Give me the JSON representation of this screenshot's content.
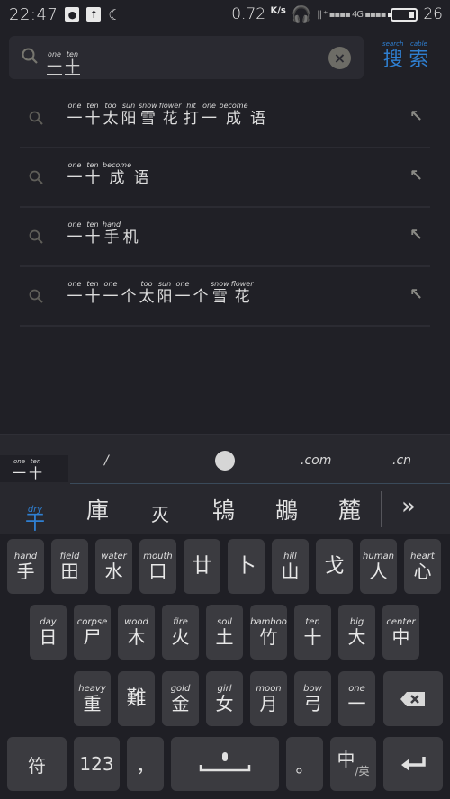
{
  "status_bar": {
    "time": "22:47",
    "left_icons": [
      "qq-icon",
      "upload-icon",
      "moon-icon"
    ],
    "net_speed": "0.72",
    "net_unit": "K/s",
    "signal": "4G",
    "battery_percent": "26"
  },
  "search": {
    "query": [
      {
        "hint": "one",
        "char": "一"
      },
      {
        "hint": "ten",
        "char": "十"
      }
    ],
    "clear_label": "×",
    "button": [
      {
        "hint": "search",
        "char": "搜"
      },
      {
        "hint": "cable",
        "char": "索"
      }
    ]
  },
  "suggestions": [
    {
      "chars": [
        {
          "hint": "one",
          "char": "一"
        },
        {
          "hint": "ten",
          "char": "十"
        },
        {
          "hint": "too",
          "char": "太"
        },
        {
          "hint": "sun",
          "char": "阳"
        },
        {
          "hint": "snow",
          "char": "雪"
        },
        {
          "hint": "flower",
          "char": "花"
        },
        {
          "hint": "hit",
          "char": "打"
        },
        {
          "hint": "one",
          "char": "一"
        },
        {
          "hint": "become",
          "char": "成"
        },
        {
          "hint": "",
          "char": "语"
        }
      ]
    },
    {
      "chars": [
        {
          "hint": "one",
          "char": "一"
        },
        {
          "hint": "ten",
          "char": "十"
        },
        {
          "hint": "become",
          "char": "成"
        },
        {
          "hint": "",
          "char": "语"
        }
      ]
    },
    {
      "chars": [
        {
          "hint": "one",
          "char": "一"
        },
        {
          "hint": "ten",
          "char": "十"
        },
        {
          "hint": "hand",
          "char": "手"
        },
        {
          "hint": "",
          "char": "机"
        }
      ]
    },
    {
      "chars": [
        {
          "hint": "one",
          "char": "一"
        },
        {
          "hint": "ten",
          "char": "十"
        },
        {
          "hint": "one",
          "char": "一"
        },
        {
          "hint": "",
          "char": "个"
        },
        {
          "hint": "too",
          "char": "太"
        },
        {
          "hint": "sun",
          "char": "阳"
        },
        {
          "hint": "one",
          "char": "一"
        },
        {
          "hint": "",
          "char": "个"
        },
        {
          "hint": "snow",
          "char": "雪"
        },
        {
          "hint": "flower",
          "char": "花"
        }
      ]
    }
  ],
  "keyboard": {
    "composition": [
      {
        "hint": "one",
        "char": "一"
      },
      {
        "hint": "ten",
        "char": "十"
      }
    ],
    "strip": {
      "slash": "/",
      "com": ".com",
      "cn": ".cn"
    },
    "candidates": {
      "first": {
        "hint": "dry",
        "char": "干"
      },
      "others": [
        "庫",
        "灭",
        "鴇",
        "鶘",
        "麓"
      ],
      "more": "»"
    },
    "row1": [
      {
        "hint": "hand",
        "char": "手"
      },
      {
        "hint": "field",
        "char": "田"
      },
      {
        "hint": "water",
        "char": "水"
      },
      {
        "hint": "mouth",
        "char": "口"
      },
      {
        "hint": "",
        "char": "廿"
      },
      {
        "hint": "",
        "char": "卜"
      },
      {
        "hint": "hill",
        "char": "山"
      },
      {
        "hint": "",
        "char": "戈"
      },
      {
        "hint": "human",
        "char": "人"
      },
      {
        "hint": "heart",
        "char": "心"
      }
    ],
    "row2": [
      {
        "hint": "day",
        "char": "日"
      },
      {
        "hint": "corpse",
        "char": "尸"
      },
      {
        "hint": "wood",
        "char": "木"
      },
      {
        "hint": "fire",
        "char": "火"
      },
      {
        "hint": "soil",
        "char": "土"
      },
      {
        "hint": "bamboo",
        "char": "竹"
      },
      {
        "hint": "ten",
        "char": "十"
      },
      {
        "hint": "big",
        "char": "大"
      },
      {
        "hint": "center",
        "char": "中"
      }
    ],
    "row3": [
      {
        "hint": "heavy",
        "char": "重"
      },
      {
        "hint": "",
        "char": "難"
      },
      {
        "hint": "gold",
        "char": "金"
      },
      {
        "hint": "girl",
        "char": "女"
      },
      {
        "hint": "moon",
        "char": "月"
      },
      {
        "hint": "bow",
        "char": "弓"
      },
      {
        "hint": "one",
        "char": "一"
      }
    ],
    "bottom": {
      "symbols": "符",
      "numbers": "123",
      "comma": "，",
      "period": "。",
      "lang_main": "中",
      "lang_sub": "/英"
    }
  }
}
